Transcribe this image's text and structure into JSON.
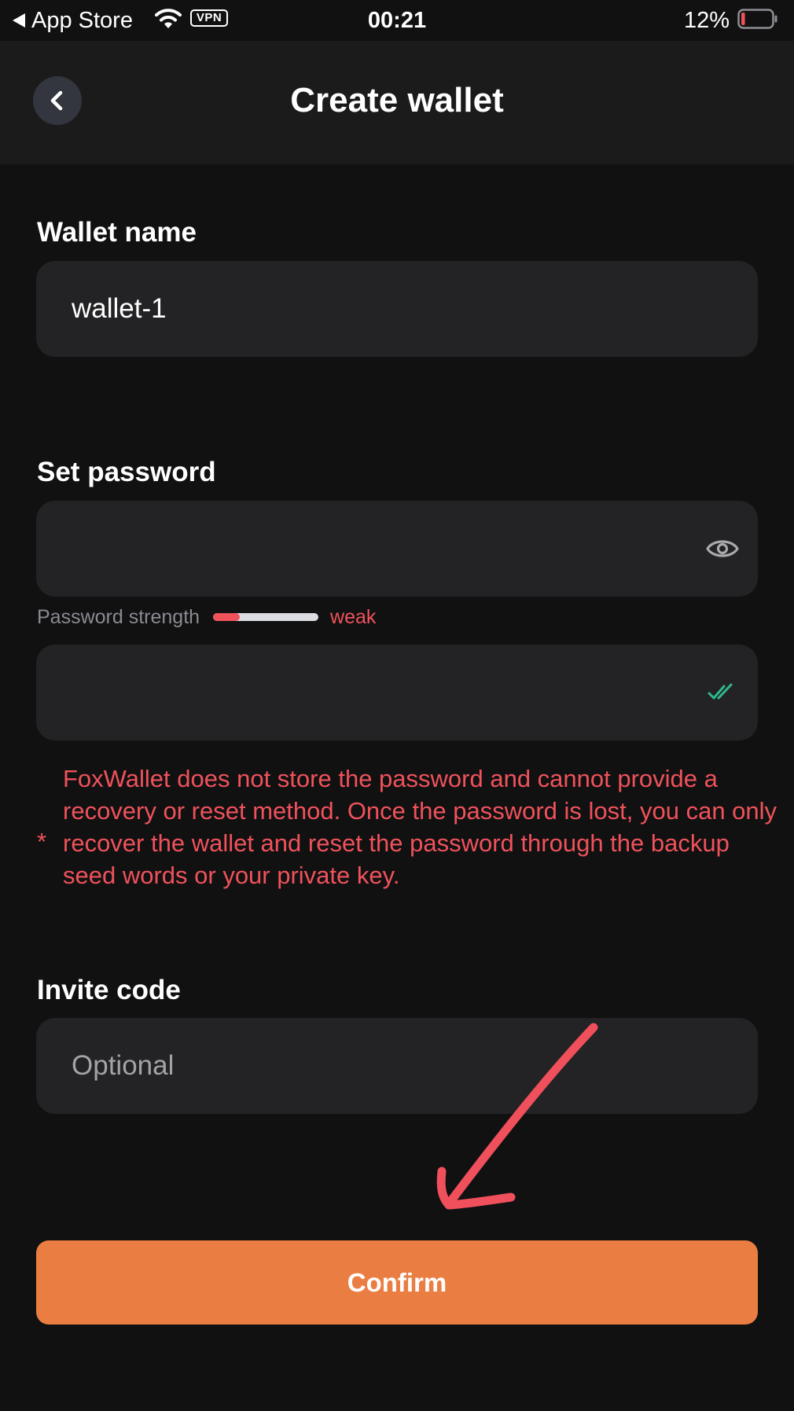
{
  "status_bar": {
    "back_app": "App Store",
    "vpn": "VPN",
    "time": "00:21",
    "battery_percent": "12%",
    "battery_level": 0.12,
    "battery_color": "#f0525b"
  },
  "header": {
    "title": "Create wallet",
    "back_icon": "chevron-left-icon"
  },
  "form": {
    "wallet_name_label": "Wallet name",
    "wallet_name_value": "wallet-1",
    "set_password_label": "Set password",
    "password_value": "",
    "password_icon": "eye-icon",
    "strength_label": "Password strength",
    "strength_value": "weak",
    "strength_level": 0.25,
    "confirm_password_value": "",
    "confirm_icon": "double-check-icon",
    "warning_star": "*",
    "warning_text": "FoxWallet does not store the password and cannot provide a recovery or reset method. Once the password is lost, you can only recover the wallet and reset the password through the backup seed words or your private key.",
    "invite_code_label": "Invite code",
    "invite_code_value": "",
    "invite_code_placeholder": "Optional"
  },
  "confirm_label": "Confirm",
  "colors": {
    "background": "#111112",
    "header": "#1b1b1c",
    "field": "#232325",
    "accent": "#ea7e42",
    "error": "#f0525b",
    "success": "#2fb98a",
    "annotation": "#f04f5c"
  }
}
